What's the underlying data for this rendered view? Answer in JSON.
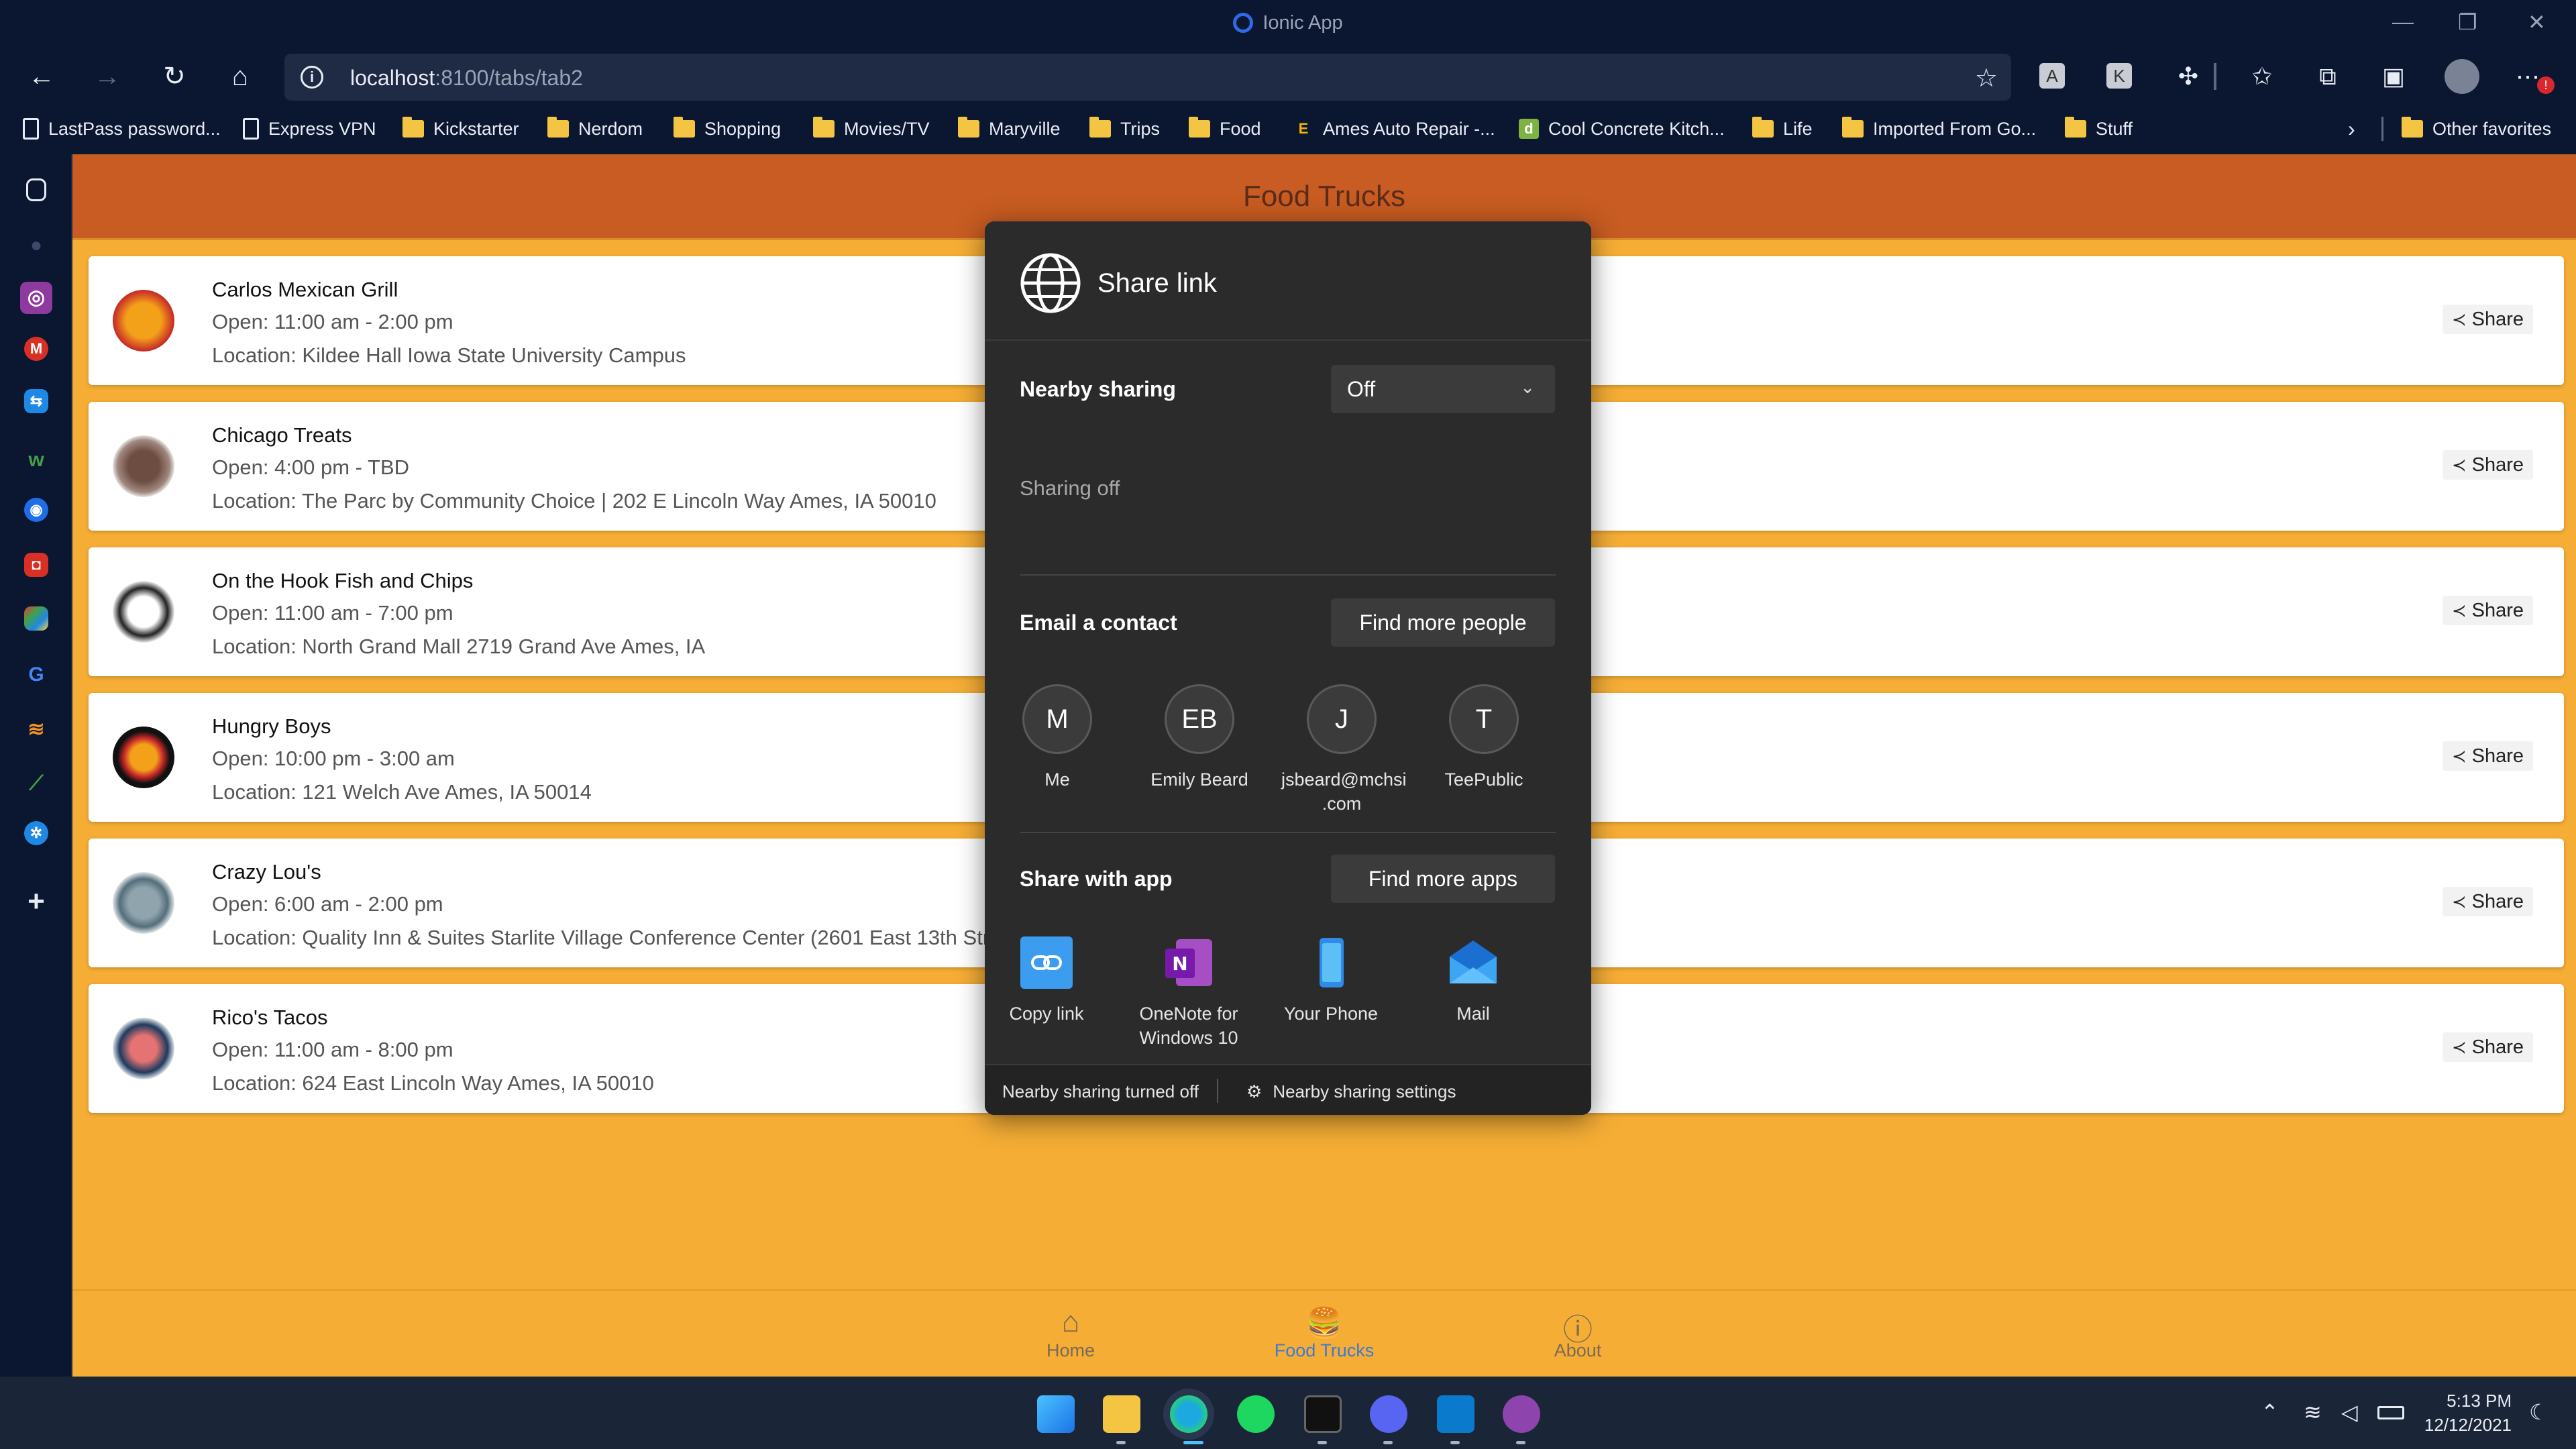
{
  "window": {
    "title": "Ionic App"
  },
  "browser": {
    "url_host": "localhost",
    "url_path": ":8100/tabs/tab2",
    "bookmarks": [
      "LastPass password...",
      "Express VPN",
      "Kickstarter",
      "Nerdom",
      "Shopping",
      "Movies/TV",
      "Maryville",
      "Trips",
      "Food",
      "Ames Auto Repair -...",
      "Cool Concrete Kitch...",
      "Life",
      "Imported From Go...",
      "Stuff"
    ],
    "other_favorites": "Other favorites",
    "bookmark_icon_letters": {
      "ames": "E",
      "cool": "d"
    },
    "notification_badge": "!"
  },
  "app": {
    "header_title": "Food Trucks",
    "share_label": "Share",
    "trucks": [
      {
        "name": "Carlos Mexican Grill",
        "open": "Open: 11:00 am - 2:00 pm",
        "location": "Location: Kildee Hall Iowa State University Campus"
      },
      {
        "name": "Chicago Treats",
        "open": "Open: 4:00 pm - TBD",
        "location": "Location: The Parc by Community Choice | 202 E Lincoln Way Ames, IA 50010"
      },
      {
        "name": "On the Hook Fish and Chips",
        "open": "Open: 11:00 am - 7:00 pm",
        "location": "Location: North Grand Mall 2719 Grand Ave Ames, IA"
      },
      {
        "name": "Hungry Boys",
        "open": "Open: 10:00 pm - 3:00 am",
        "location": "Location: 121 Welch Ave Ames, IA 50014"
      },
      {
        "name": "Crazy Lou's",
        "open": "Open: 6:00 am - 2:00 pm",
        "location": "Location: Quality Inn & Suites Starlite Village Conference Center (2601 East 13th Str"
      },
      {
        "name": "Rico's Tacos",
        "open": "Open: 11:00 am - 8:00 pm",
        "location": "Location: 624 East Lincoln Way Ames, IA 50010"
      }
    ],
    "tabs": [
      {
        "label": "Home"
      },
      {
        "label": "Food Trucks"
      },
      {
        "label": "About"
      }
    ]
  },
  "share_dialog": {
    "title": "Share link",
    "nearby_label": "Nearby sharing",
    "nearby_value": "Off",
    "sharing_status": "Sharing off",
    "email_label": "Email a contact",
    "find_people": "Find more people",
    "contacts": [
      {
        "initials": "M",
        "name": "Me"
      },
      {
        "initials": "EB",
        "name": "Emily Beard"
      },
      {
        "initials": "J",
        "name": "jsbeard@mchsi\n.com"
      },
      {
        "initials": "T",
        "name": "TeePublic"
      }
    ],
    "app_label": "Share with app",
    "find_apps": "Find more apps",
    "apps": [
      {
        "name": "Copy link"
      },
      {
        "name": "OneNote for\nWindows 10"
      },
      {
        "name": "Your Phone"
      },
      {
        "name": "Mail"
      }
    ],
    "footer_status": "Nearby sharing turned off",
    "footer_settings": "Nearby sharing settings"
  },
  "taskbar": {
    "time": "5:13 PM",
    "date": "12/12/2021"
  }
}
